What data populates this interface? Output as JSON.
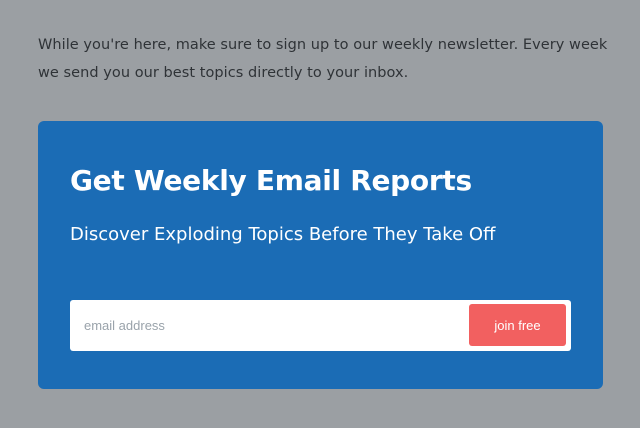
{
  "intro": {
    "text": "While you're here, make sure to sign up to our weekly newsletter. Every week we send you our best topics directly to your inbox."
  },
  "newsletter": {
    "title": "Get Weekly Email Reports",
    "subtitle": "Discover Exploding Topics Before They Take Off",
    "email_placeholder": "email address",
    "email_value": "",
    "submit_label": "join free"
  },
  "colors": {
    "page_background": "#9b9fa3",
    "card_background": "#1b6cb5",
    "button_background": "#f26060",
    "text_dark": "#2f3337"
  }
}
